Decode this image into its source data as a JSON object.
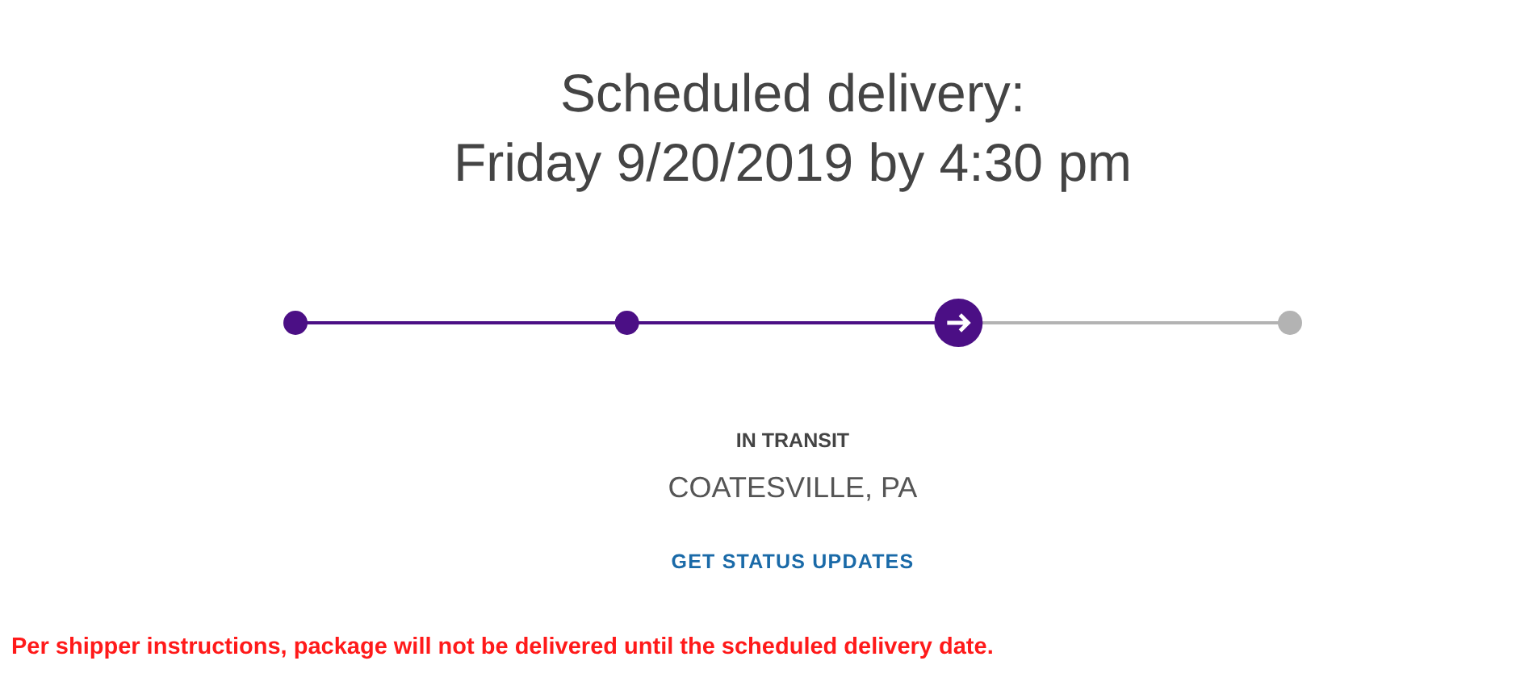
{
  "heading": {
    "label": "Scheduled delivery:",
    "date": "Friday 9/20/2019 by 4:30 pm"
  },
  "progress": [
    {
      "completed": true,
      "current": false
    },
    {
      "completed": true,
      "current": false
    },
    {
      "completed": false,
      "current": true
    },
    {
      "completed": false,
      "current": false
    }
  ],
  "status": {
    "label": "IN TRANSIT",
    "location": "COATESVILLE, PA"
  },
  "link": "GET STATUS UPDATES",
  "notice": "Per shipper instructions, package will not be delivered until the scheduled delivery date."
}
